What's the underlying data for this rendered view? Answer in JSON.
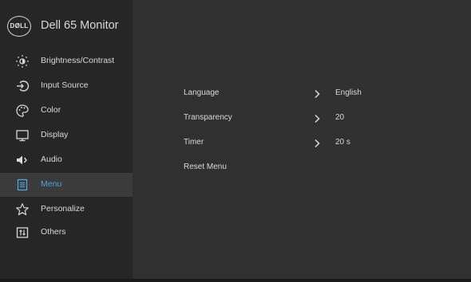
{
  "header": {
    "logo_text": "DØLL",
    "model": "Dell 65 Monitor"
  },
  "nav": [
    {
      "label": "Brightness/Contrast",
      "icon": "brightness-icon"
    },
    {
      "label": "Input Source",
      "icon": "input-source-icon"
    },
    {
      "label": "Color",
      "icon": "color-palette-icon"
    },
    {
      "label": "Display",
      "icon": "display-icon"
    },
    {
      "label": "Audio",
      "icon": "speaker-icon"
    },
    {
      "label": "Menu",
      "icon": "menu-icon",
      "active": true
    },
    {
      "label": "Personalize",
      "icon": "star-icon"
    },
    {
      "label": "Others",
      "icon": "others-icon"
    }
  ],
  "menu_settings": [
    {
      "label": "Language",
      "value": "English"
    },
    {
      "label": "Transparency",
      "value": "20"
    },
    {
      "label": "Timer",
      "value": "20 s"
    },
    {
      "label": "Reset Menu"
    }
  ],
  "colors": {
    "background": "#303030",
    "sidebar": "#262626",
    "active": "#3b3b3b",
    "accent": "#4aa3df",
    "text": "#d8d8d8"
  }
}
